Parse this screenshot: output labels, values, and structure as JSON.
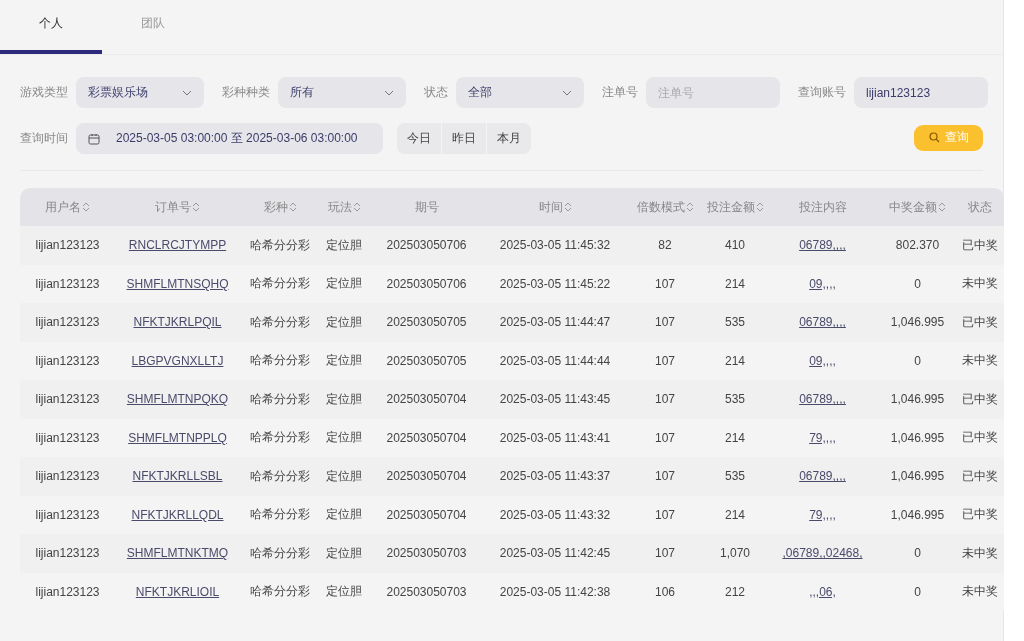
{
  "tabs": [
    {
      "label": "个人",
      "selected": true
    },
    {
      "label": "团队",
      "selected": false
    }
  ],
  "filters": [
    {
      "kind": "select",
      "label": "游戏类型",
      "value": "彩票娱乐场"
    },
    {
      "kind": "select",
      "label": "彩种种类",
      "value": "所有"
    },
    {
      "kind": "select",
      "label": "状态",
      "value": "全部"
    },
    {
      "kind": "input",
      "label": "注单号",
      "placeholder": "注单号"
    },
    {
      "kind": "input",
      "label": "查询账号",
      "value": "lijian123123"
    }
  ],
  "time_filter": {
    "label": "查询时间",
    "value": "2025-03-05 03:00:00 至 2025-03-06 03:00:00"
  },
  "quick_ranges": [
    "今日",
    "昨日",
    "本月"
  ],
  "search_button": "查询",
  "table": {
    "columns": [
      {
        "label": "用户名",
        "sortable": true
      },
      {
        "label": "订单号",
        "sortable": true
      },
      {
        "label": "彩种",
        "sortable": true
      },
      {
        "label": "玩法",
        "sortable": true
      },
      {
        "label": "期号",
        "sortable": false
      },
      {
        "label": "时间",
        "sortable": true
      },
      {
        "label": "倍数模式",
        "sortable": true
      },
      {
        "label": "投注金额",
        "sortable": true
      },
      {
        "label": "投注内容",
        "sortable": false
      },
      {
        "label": "中奖金额",
        "sortable": true
      },
      {
        "label": "状态",
        "sortable": false
      }
    ],
    "rows": [
      [
        "lijian123123",
        "RNCLRCJTYMPP",
        "哈希分分彩",
        "定位胆",
        "202503050706",
        "2025-03-05 11:45:32",
        "82",
        "410",
        "06789,,,,",
        "802.370",
        "已中奖"
      ],
      [
        "lijian123123",
        "SHMFLMTNSQHQ",
        "哈希分分彩",
        "定位胆",
        "202503050706",
        "2025-03-05 11:45:22",
        "107",
        "214",
        "09,,,,",
        "0",
        "未中奖"
      ],
      [
        "lijian123123",
        "NFKTJKRLPQIL",
        "哈希分分彩",
        "定位胆",
        "202503050705",
        "2025-03-05 11:44:47",
        "107",
        "535",
        "06789,,,,",
        "1,046.995",
        "已中奖"
      ],
      [
        "lijian123123",
        "LBGPVGNXLLTJ",
        "哈希分分彩",
        "定位胆",
        "202503050705",
        "2025-03-05 11:44:44",
        "107",
        "214",
        "09,,,,",
        "0",
        "未中奖"
      ],
      [
        "lijian123123",
        "SHMFLMTNPQKQ",
        "哈希分分彩",
        "定位胆",
        "202503050704",
        "2025-03-05 11:43:45",
        "107",
        "535",
        "06789,,,,",
        "1,046.995",
        "已中奖"
      ],
      [
        "lijian123123",
        "SHMFLMTNPPLQ",
        "哈希分分彩",
        "定位胆",
        "202503050704",
        "2025-03-05 11:43:41",
        "107",
        "214",
        "79,,,,",
        "1,046.995",
        "已中奖"
      ],
      [
        "lijian123123",
        "NFKTJKRLLSBL",
        "哈希分分彩",
        "定位胆",
        "202503050704",
        "2025-03-05 11:43:37",
        "107",
        "535",
        "06789,,,,",
        "1,046.995",
        "已中奖"
      ],
      [
        "lijian123123",
        "NFKTJKRLLQDL",
        "哈希分分彩",
        "定位胆",
        "202503050704",
        "2025-03-05 11:43:32",
        "107",
        "214",
        "79,,,,",
        "1,046.995",
        "已中奖"
      ],
      [
        "lijian123123",
        "SHMFLMTNKTMQ",
        "哈希分分彩",
        "定位胆",
        "202503050703",
        "2025-03-05 11:42:45",
        "107",
        "1,070",
        ",06789,,02468,",
        "0",
        "未中奖"
      ],
      [
        "lijian123123",
        "NFKTJKRLIOIL",
        "哈希分分彩",
        "定位胆",
        "202503050703",
        "2025-03-05 11:42:38",
        "106",
        "212",
        ",,,06,",
        "0",
        "未中奖"
      ]
    ]
  }
}
